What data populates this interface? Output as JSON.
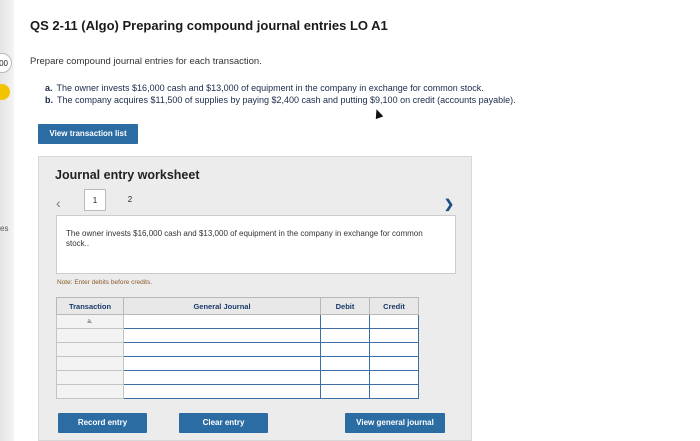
{
  "title": "QS 2-11 (Algo) Preparing compound journal entries LO A1",
  "edge": {
    "badge_text": "00",
    "side_text": "es"
  },
  "instruction": "Prepare compound journal entries for each transaction.",
  "transactions": [
    {
      "letter": "a.",
      "text": "The owner invests $16,000 cash and $13,000 of equipment in the company in exchange for common stock."
    },
    {
      "letter": "b.",
      "text": "The company acquires $11,500 of supplies by paying $2,400 cash and putting $9,100 on credit (accounts payable)."
    }
  ],
  "buttons": {
    "view_transaction_list": "View transaction list",
    "record_entry": "Record entry",
    "clear_entry": "Clear entry",
    "view_general_journal": "View general journal"
  },
  "worksheet": {
    "title": "Journal entry worksheet",
    "tabs": [
      "1",
      "2"
    ],
    "active_tab": "1",
    "description": "The owner invests $16,000 cash and $13,000 of equipment in the company in exchange for common stock..",
    "note": "Note: Enter debits before credits.",
    "columns": {
      "transaction": "Transaction",
      "general_journal": "General Journal",
      "debit": "Debit",
      "credit": "Credit"
    },
    "rows": [
      {
        "transaction": "a."
      },
      {
        "transaction": ""
      },
      {
        "transaction": ""
      },
      {
        "transaction": ""
      },
      {
        "transaction": ""
      },
      {
        "transaction": ""
      }
    ]
  }
}
